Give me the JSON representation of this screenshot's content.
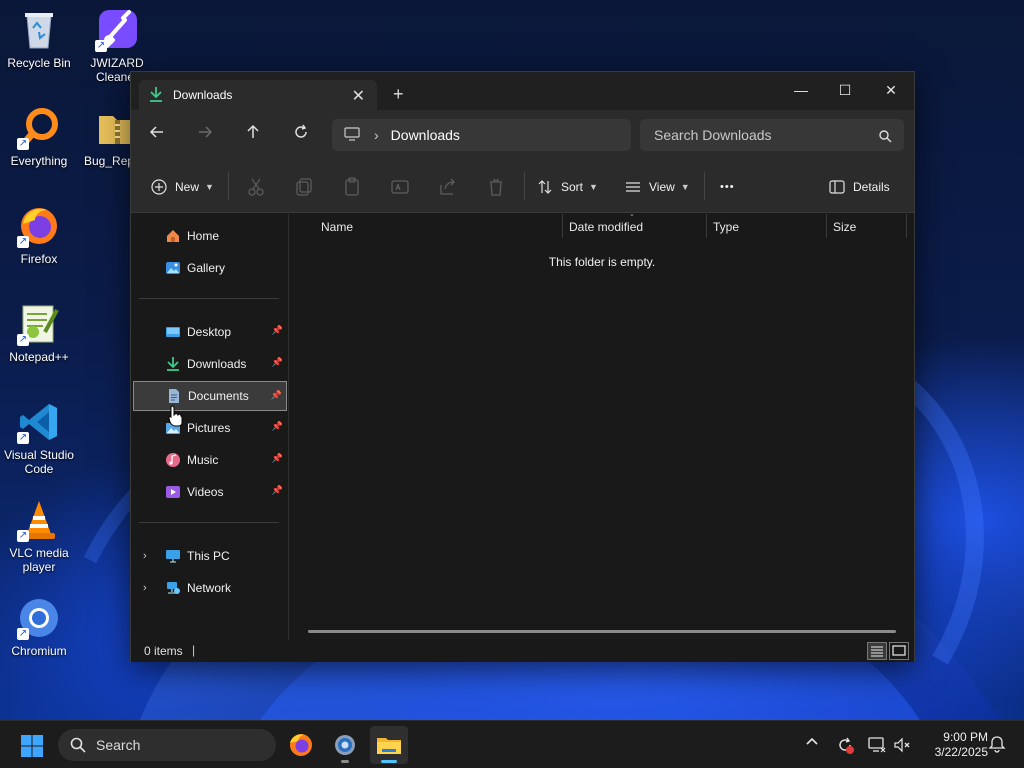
{
  "desktop": {
    "icons": [
      {
        "label": "Recycle Bin",
        "icon": "recycle-bin-icon"
      },
      {
        "label": "JWIZARD Cleaner",
        "icon": "jwizard-cleaner-icon"
      },
      {
        "label": "Everything",
        "icon": "everything-search-icon"
      },
      {
        "label": "Bug_Rep",
        "icon": "zip-folder-icon"
      },
      {
        "label": "Firefox",
        "icon": "firefox-icon"
      },
      {
        "label": "Notepad++",
        "icon": "notepadpp-icon"
      },
      {
        "label": "Visual Studio Code",
        "icon": "vscode-icon"
      },
      {
        "label": "VLC media player",
        "icon": "vlc-icon"
      },
      {
        "label": "Chromium",
        "icon": "chromium-icon"
      }
    ]
  },
  "explorer": {
    "tab": {
      "title": "Downloads",
      "close": "✕",
      "new_tab": "+"
    },
    "window_controls": {
      "minimize": "—",
      "maximize": "☐",
      "close": "✕"
    },
    "address": {
      "location": "Downloads"
    },
    "search": {
      "placeholder": "Search Downloads"
    },
    "commands": {
      "new_label": "New",
      "sort_label": "Sort",
      "view_label": "View",
      "more_label": "•••",
      "details_label": "Details"
    },
    "sidebar": {
      "home": "Home",
      "gallery": "Gallery",
      "desktop": "Desktop",
      "downloads": "Downloads",
      "documents": "Documents",
      "pictures": "Pictures",
      "music": "Music",
      "videos": "Videos",
      "this_pc": "This PC",
      "network": "Network",
      "selected": "Documents"
    },
    "columns": [
      "Name",
      "Date modified",
      "Type",
      "Size"
    ],
    "empty_message": "This folder is empty.",
    "status": {
      "item_count": "0 items"
    }
  },
  "taskbar": {
    "search_label": "Search",
    "apps": [
      "firefox-icon",
      "settings-gear-icon",
      "file-explorer-icon"
    ],
    "active_app": "file-explorer-icon",
    "clock": {
      "time": "9:00 PM",
      "date": "3/22/2025"
    }
  },
  "colors": {
    "accent": "#4cc2ff",
    "window_bg": "#191919",
    "toolbar_bg": "#2b2b2b",
    "selection_border": "#8a8a8a"
  }
}
